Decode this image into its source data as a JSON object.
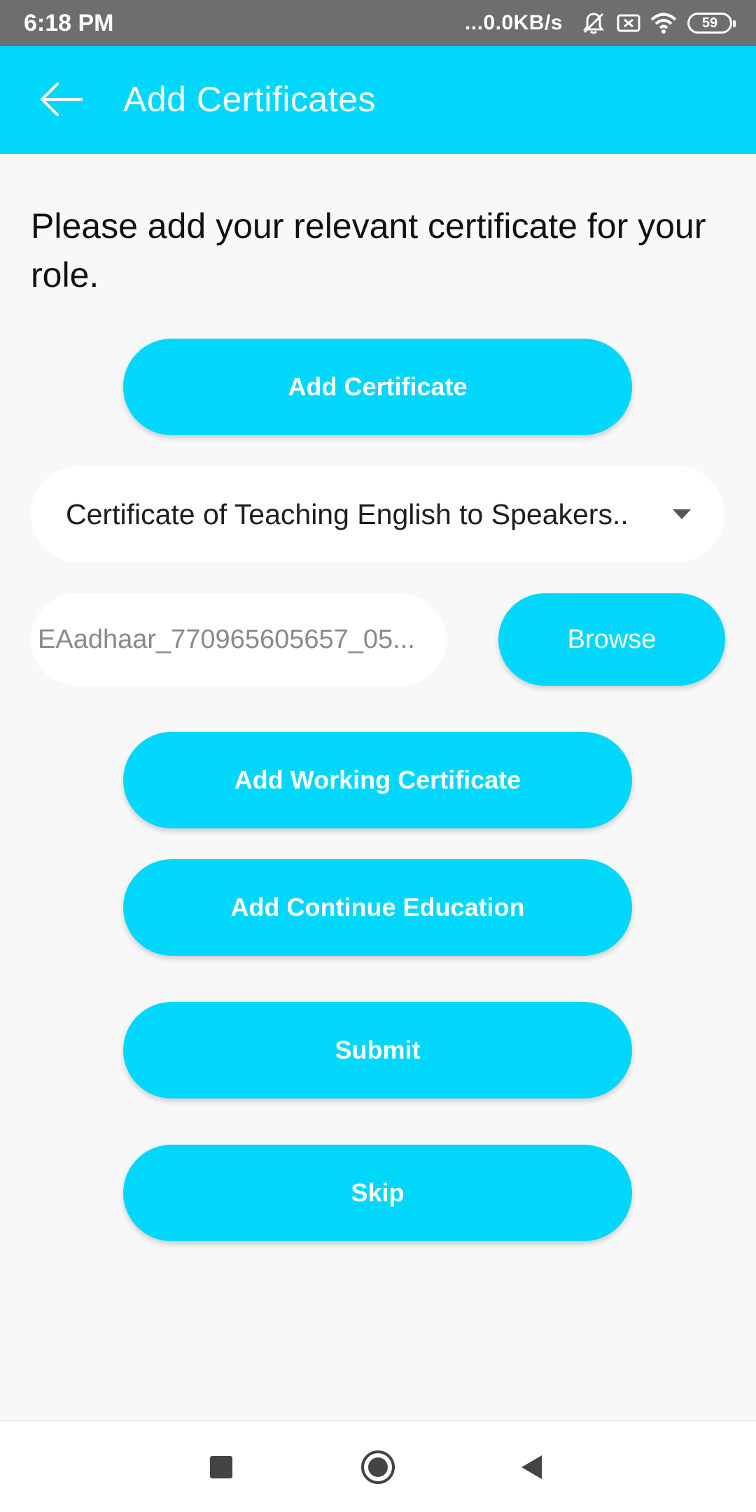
{
  "status_bar": {
    "time": "6:18 PM",
    "network_speed": "...0.0KB/s",
    "battery_level": "59",
    "icons": [
      "mute-icon",
      "sim-icon",
      "wifi-icon",
      "battery-icon"
    ]
  },
  "app_bar": {
    "title": "Add Certificates",
    "back_icon": "arrow-left-icon"
  },
  "main": {
    "instructions": "Please add your relevant certificate for your role.",
    "add_certificate_label": "Add Certificate",
    "certificate_dropdown": {
      "selected_value": "Certificate of Teaching English to Speakers.."
    },
    "file_field": {
      "value": "EAadhaar_770965605657_05..."
    },
    "browse_label": "Browse",
    "add_working_certificate_label": "Add Working Certificate",
    "add_continue_education_label": "Add Continue Education",
    "submit_label": "Submit",
    "skip_label": "Skip"
  },
  "nav_bar": {
    "icons": [
      "recents-square-icon",
      "home-circle-icon",
      "back-triangle-icon"
    ]
  },
  "colors": {
    "accent": "#00d7fb",
    "status_bar": "#6e6e6e",
    "background": "#f8f8f8"
  }
}
